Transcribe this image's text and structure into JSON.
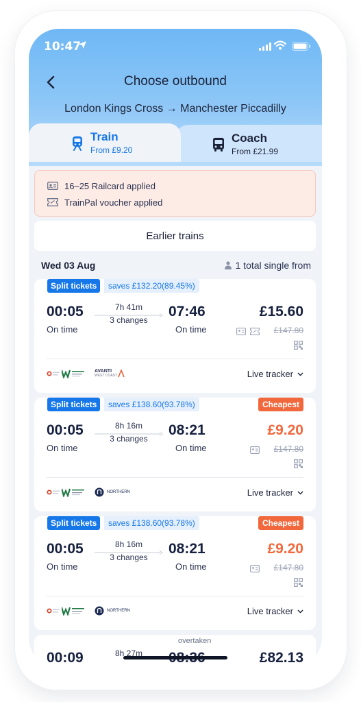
{
  "status_bar": {
    "time": "10:47"
  },
  "header": {
    "title": "Choose outbound",
    "route": "London Kings Cross → Manchester Piccadilly"
  },
  "tabs": [
    {
      "name": "Train",
      "sub": "From £9.20",
      "active": true
    },
    {
      "name": "Coach",
      "sub": "From £21.99",
      "active": false
    }
  ],
  "applied": [
    {
      "icon": "railcard-icon",
      "text": "16–25 Railcard applied"
    },
    {
      "icon": "voucher-icon",
      "text": "TrainPal voucher applied"
    }
  ],
  "earlier_label": "Earlier trains",
  "date_row": {
    "date": "Wed 03 Aug",
    "pax": "1 total single from"
  },
  "journeys": [
    {
      "split": "Split tickets",
      "saves": "saves £132.20(89.45%)",
      "badge": "",
      "dep": "00:05",
      "dep_status": "On time",
      "duration": "7h 41m",
      "changes": "3 changes",
      "arr": "07:46",
      "arr_status": "On time",
      "price": "£15.60",
      "was": "£147.80",
      "operators": [
        "West Midlands Railway",
        "London Northwestern",
        "Avanti West Coast"
      ],
      "live": "Live tracker"
    },
    {
      "split": "Split tickets",
      "saves": "saves £138.60(93.78%)",
      "badge": "Cheapest",
      "dep": "00:05",
      "dep_status": "On time",
      "duration": "8h 16m",
      "changes": "3 changes",
      "arr": "08:21",
      "arr_status": "On time",
      "price": "£9.20",
      "was": "£147.80",
      "operators": [
        "West Midlands Railway",
        "London Northwestern",
        "Northern"
      ],
      "live": "Live tracker"
    },
    {
      "split": "Split tickets",
      "saves": "saves £138.60(93.78%)",
      "badge": "Cheapest",
      "dep": "00:05",
      "dep_status": "On time",
      "duration": "8h 16m",
      "changes": "3 changes",
      "arr": "08:21",
      "arr_status": "On time",
      "price": "£9.20",
      "was": "£147.80",
      "operators": [
        "West Midlands Railway",
        "London Northwestern",
        "Northern"
      ],
      "live": "Live tracker"
    }
  ],
  "partial_journey": {
    "note": "overtaken",
    "dep": "00:09",
    "duration": "8h 27m",
    "arr": "08:36",
    "price": "£82.13"
  },
  "operator_text": {
    "avanti": "AVANTI",
    "avanti_sub": "WEST COAST",
    "northern": "NORTHERN"
  },
  "colors": {
    "accent": "#1677e8",
    "cheapest": "#f2683d",
    "text": "#1b2137",
    "banner_bg": "#fdebe6"
  }
}
